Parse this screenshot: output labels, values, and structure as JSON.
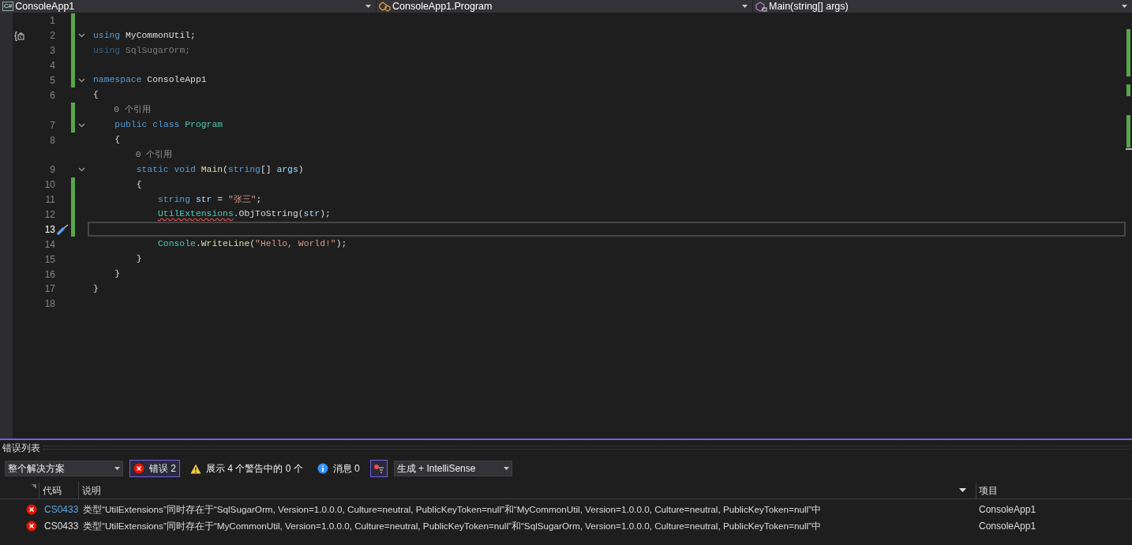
{
  "navigation_bar": [
    {
      "kind": "project",
      "icon_text": "C#",
      "label": "ConsoleApp1"
    },
    {
      "kind": "class",
      "label": "ConsoleApp1.Program"
    },
    {
      "kind": "method",
      "label": "Main(string[] args)"
    }
  ],
  "editor": {
    "lines": [
      {
        "number": "1",
        "changed": true,
        "fold": false,
        "current": false
      },
      {
        "number": "2",
        "changed": true,
        "fold": true,
        "current": false,
        "glyph": {
          "kind": "namespace_import",
          "text": "{"
        },
        "tokens": [
          {
            "kind": "keyword",
            "text": "using"
          },
          {
            "kind": "plain",
            "text": " MyCommonUtil;"
          }
        ]
      },
      {
        "number": "3",
        "changed": true,
        "fold": false,
        "current": false,
        "tokens": [
          {
            "kind": "keyword_dim",
            "text": "using"
          },
          {
            "kind": "plain_dim",
            "text": " SqlSugarOrm;"
          }
        ]
      },
      {
        "number": "4",
        "changed": true,
        "fold": false,
        "current": false
      },
      {
        "number": "5",
        "changed": true,
        "fold": true,
        "current": false,
        "tokens": [
          {
            "kind": "keyword",
            "text": "namespace"
          },
          {
            "kind": "plain",
            "text": " ConsoleApp1"
          }
        ]
      },
      {
        "number": "6",
        "changed": false,
        "fold": false,
        "current": false,
        "tokens": [
          {
            "kind": "plain",
            "text": "{"
          }
        ]
      },
      {
        "number": "7",
        "changed": true,
        "fold": true,
        "current": false,
        "lens": "0 个引用",
        "tokens": [
          {
            "kind": "keyword",
            "text": "    public class"
          },
          {
            "kind": "type",
            "text": " Program"
          }
        ]
      },
      {
        "number": "8",
        "changed": false,
        "fold": false,
        "current": false,
        "tokens": [
          {
            "kind": "plain",
            "text": "    {"
          }
        ]
      },
      {
        "number": "9",
        "changed": false,
        "fold": true,
        "current": false,
        "lens": "0 个引用",
        "tokens": [
          {
            "kind": "keyword",
            "text": "        static void"
          },
          {
            "kind": "method",
            "text": " Main"
          },
          {
            "kind": "plain",
            "text": "("
          },
          {
            "kind": "keyword",
            "text": "string"
          },
          {
            "kind": "plain",
            "text": "[] "
          },
          {
            "kind": "param",
            "text": "args"
          },
          {
            "kind": "plain",
            "text": ")"
          }
        ]
      },
      {
        "number": "10",
        "changed": true,
        "fold": false,
        "current": false,
        "tokens": [
          {
            "kind": "plain",
            "text": "        {"
          }
        ]
      },
      {
        "number": "11",
        "changed": true,
        "fold": false,
        "current": false,
        "tokens": [
          {
            "kind": "keyword",
            "text": "            string"
          },
          {
            "kind": "param",
            "text": " str"
          },
          {
            "kind": "plain",
            "text": " = "
          },
          {
            "kind": "string",
            "text": "\"张三\""
          },
          {
            "kind": "plain",
            "text": ";"
          }
        ]
      },
      {
        "number": "12",
        "changed": true,
        "fold": false,
        "current": false,
        "tokens": [
          {
            "kind": "type_error",
            "text": "            UtilExtensions"
          },
          {
            "kind": "plain",
            "text": ".ObjToString("
          },
          {
            "kind": "param",
            "text": "str"
          },
          {
            "kind": "plain",
            "text": ");"
          }
        ]
      },
      {
        "number": "13",
        "changed": true,
        "fold": false,
        "current": true,
        "glyph": {
          "kind": "quick_action"
        }
      },
      {
        "number": "14",
        "changed": false,
        "fold": false,
        "current": false,
        "tokens": [
          {
            "kind": "type",
            "text": "            Console"
          },
          {
            "kind": "plain",
            "text": "."
          },
          {
            "kind": "method",
            "text": "WriteLine"
          },
          {
            "kind": "plain",
            "text": "("
          },
          {
            "kind": "string",
            "text": "\"Hello, World!\""
          },
          {
            "kind": "plain",
            "text": ");"
          }
        ]
      },
      {
        "number": "15",
        "changed": false,
        "fold": false,
        "current": false,
        "tokens": [
          {
            "kind": "plain",
            "text": "        }"
          }
        ]
      },
      {
        "number": "16",
        "changed": false,
        "fold": false,
        "current": false,
        "tokens": [
          {
            "kind": "plain",
            "text": "    }"
          }
        ]
      },
      {
        "number": "17",
        "changed": false,
        "fold": false,
        "current": false,
        "tokens": [
          {
            "kind": "plain",
            "text": "}"
          }
        ]
      },
      {
        "number": "18",
        "changed": false,
        "fold": false,
        "current": false
      }
    ]
  },
  "error_list": {
    "title": "错误列表",
    "scope": "整个解决方案",
    "filters": [
      {
        "kind": "error",
        "label": "错误 2",
        "selected": true
      },
      {
        "kind": "warning",
        "label": "展示 4 个警告中的 0 个",
        "selected": false
      },
      {
        "kind": "info",
        "label": "消息 0",
        "selected": false
      },
      {
        "kind": "filter_icon",
        "selected": true
      }
    ],
    "source": "生成 + IntelliSense",
    "columns": [
      "代码",
      "说明",
      "项目"
    ],
    "rows": [
      {
        "code": "CS0433",
        "highlighted": true,
        "description": "类型“UtilExtensions”同时存在于“SqlSugarOrm, Version=1.0.0.0, Culture=neutral, PublicKeyToken=null”和“MyCommonUtil, Version=1.0.0.0, Culture=neutral, PublicKeyToken=null”中",
        "project": "ConsoleApp1"
      },
      {
        "code": "CS0433",
        "highlighted": false,
        "description": "类型“UtilExtensions”同时存在于“MyCommonUtil, Version=1.0.0.0, Culture=neutral, PublicKeyToken=null”和“SqlSugarOrm, Version=1.0.0.0, Culture=neutral, PublicKeyToken=null”中",
        "project": "ConsoleApp1"
      }
    ]
  }
}
